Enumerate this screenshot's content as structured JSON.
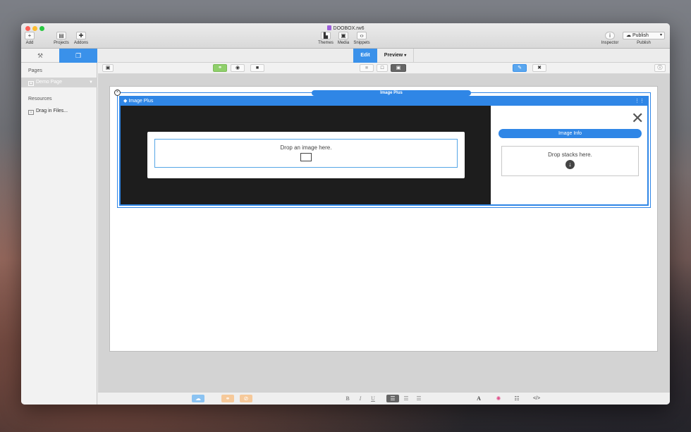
{
  "window": {
    "title": "DOOBOX.rw6"
  },
  "toolbar": {
    "add_label": "Add",
    "projects_label": "Projects",
    "addons_label": "Addons",
    "themes_label": "Themes",
    "media_label": "Media",
    "snippets_label": "Snippets",
    "inspector_label": "Inspector",
    "publish_button": "Publish",
    "publish_label": "Publish"
  },
  "sidebar": {
    "pages_heading": "Pages",
    "pages": [
      {
        "label": "Demo Page"
      }
    ],
    "resources_heading": "Resources",
    "resources": [
      {
        "label": "Drag in Files..."
      }
    ]
  },
  "mode_tabs": {
    "edit": "Edit",
    "preview": "Preview"
  },
  "stack": {
    "outer_label": "Image Plus",
    "inner_label": "Image Plus",
    "image_drop_text": "Drop an image here.",
    "image_info_button": "Image Info",
    "stacks_drop_text": "Drop stacks here."
  },
  "format_bar": {
    "bold": "B",
    "italic": "I",
    "underline": "U",
    "font": "A",
    "code": "</>"
  },
  "colors": {
    "accent": "#3a91ea",
    "stack_blue": "#2f86e6",
    "dark_panel": "#1d1d1d"
  }
}
